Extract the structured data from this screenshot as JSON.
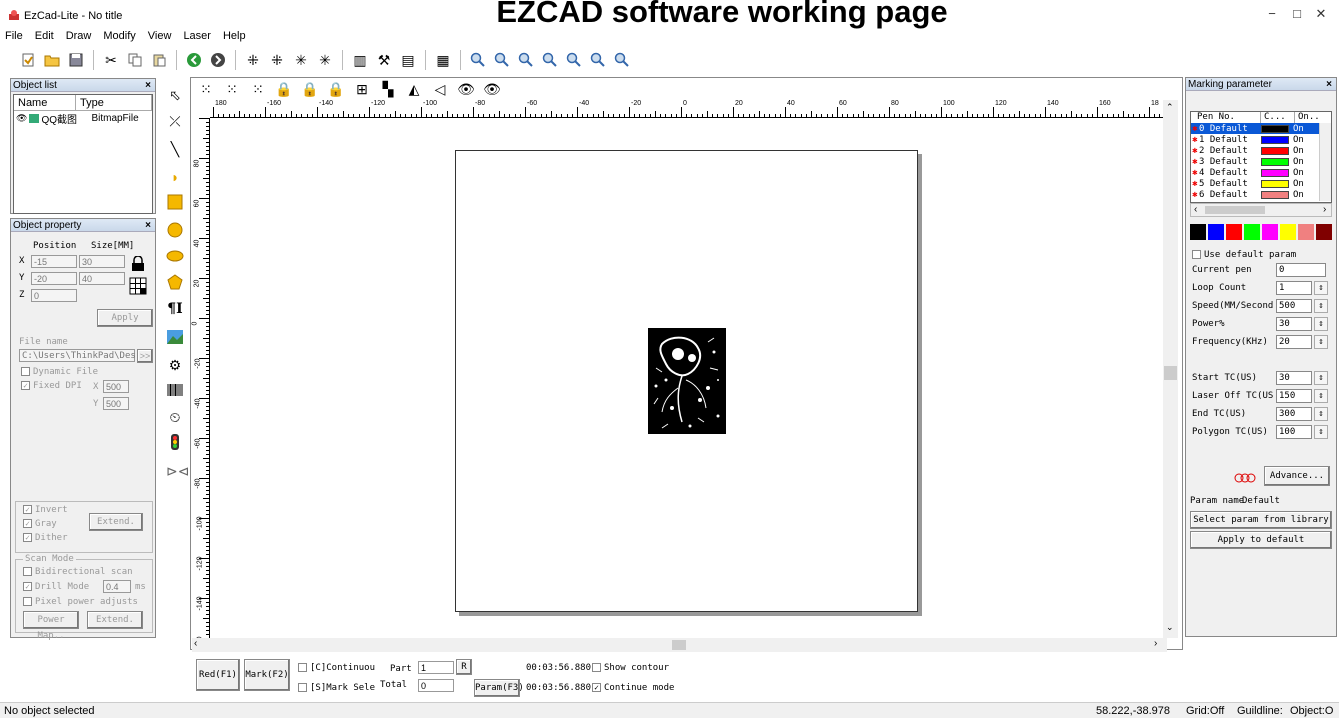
{
  "app": {
    "title": "EzCad-Lite  - No title",
    "banner": "EZCAD software working page",
    "window_controls": [
      "−",
      "□",
      "✕"
    ]
  },
  "menu": [
    "File",
    "Edit",
    "Draw",
    "Modify",
    "View",
    "Laser",
    "Help"
  ],
  "object_list": {
    "title": "Object list",
    "close": "×",
    "col_name": "Name",
    "col_type": "Type",
    "rows": [
      {
        "name": "QQ截图",
        "type": "BitmapFile"
      }
    ]
  },
  "object_property": {
    "title": "Object property",
    "close": "×",
    "position_label": "Position",
    "size_label": "Size[MM]",
    "x_label": "X",
    "y_label": "Y",
    "z_label": "Z",
    "x_value": "-15",
    "y_value": "-20",
    "z_value": "0",
    "width_value": "30",
    "height_value": "40",
    "apply_label": "Apply",
    "file_name_label": "File name",
    "file_path": "C:\\Users\\ThinkPad\\Des",
    "browse_label": ">>",
    "dynamic_file_label": "Dynamic File",
    "fixed_dpi_label": "Fixed DPI",
    "dpi_x_label": "X",
    "dpi_y_label": "Y",
    "dpi_x": "500",
    "dpi_y": "500",
    "invert_label": "Invert",
    "gray_label": "Gray",
    "dither_label": "Dither",
    "extend_label": "Extend.",
    "scan_mode_label": "Scan Mode",
    "bidirectional_label": "Bidirectional scan",
    "drill_mode_label": "Drill Mode",
    "drill_value": "0.4",
    "drill_unit": "ms",
    "pixel_power_label": "Pixel power adjusts",
    "power_map_label": "Power Map..",
    "extend2_label": "Extend."
  },
  "ruler": {
    "h_labels": [
      "180",
      "-160",
      "-140",
      "-120",
      "-100",
      "-80",
      "-60",
      "-40",
      "-20",
      "0",
      "20",
      "40",
      "60",
      "80",
      "100",
      "120",
      "140",
      "160",
      "18"
    ],
    "v_labels": [
      "80",
      "60",
      "40",
      "20",
      "0",
      "-20",
      "-40",
      "-60",
      "-80",
      "-100",
      "-120",
      "-140",
      "-160"
    ]
  },
  "bottom": {
    "red_label": "Red(F1)",
    "mark_label": "Mark(F2)",
    "continuous_label": "[C]Continuou",
    "mark_sel_label": "[S]Mark Sele",
    "part_label": "Part",
    "part_value": "1",
    "r_label": "R",
    "total_label": "Total",
    "total_value": "0",
    "param_label": "Param(F3)",
    "time1": "00:03:56.880",
    "time2": "00:03:56.880",
    "show_contour_label": "Show contour",
    "continue_mode_label": "Continue mode"
  },
  "marking": {
    "title": "Marking parameter",
    "close": "×",
    "col_pen": "Pen No.",
    "col_c": "C...",
    "col_on": "On..",
    "pens": [
      {
        "label": "0 Default",
        "color": "#000000",
        "on": "On"
      },
      {
        "label": "1 Default",
        "color": "#0000ff",
        "on": "On"
      },
      {
        "label": "2 Default",
        "color": "#ff0000",
        "on": "On"
      },
      {
        "label": "3 Default",
        "color": "#00ff00",
        "on": "On"
      },
      {
        "label": "4 Default",
        "color": "#ff00ff",
        "on": "On"
      },
      {
        "label": "5 Default",
        "color": "#ffff00",
        "on": "On"
      },
      {
        "label": "6 Default",
        "color": "#f08080",
        "on": "On"
      }
    ],
    "palette": [
      "#000000",
      "#0000ff",
      "#ff0000",
      "#00ff00",
      "#ff00ff",
      "#ffff00",
      "#f08080",
      "#800000"
    ],
    "use_default_label": "Use default param",
    "params": [
      {
        "label": "Current pen",
        "value": "0",
        "spin": false
      },
      {
        "label": "Loop Count",
        "value": "1",
        "spin": true
      },
      {
        "label": "Speed(MM/Second",
        "value": "500",
        "spin": true
      },
      {
        "label": "Power%",
        "value": "30",
        "spin": true
      },
      {
        "label": "Frequency(KHz)",
        "value": "20",
        "spin": true
      }
    ],
    "tc_params": [
      {
        "label": "Start TC(US)",
        "value": "30"
      },
      {
        "label": "Laser Off TC(US",
        "value": "150"
      },
      {
        "label": "End TC(US)",
        "value": "300"
      },
      {
        "label": "Polygon TC(US)",
        "value": "100"
      }
    ],
    "advance_label": "Advance...",
    "param_name_label": "Param name",
    "param_name_value": "Default",
    "select_library_label": "Select param from library",
    "apply_default_label": "Apply to default"
  },
  "status": {
    "left": "No object selected",
    "coords": "58.222,-38.978",
    "grid": "Grid:Off",
    "guideline": "Guildline:",
    "object": "Object:O"
  }
}
